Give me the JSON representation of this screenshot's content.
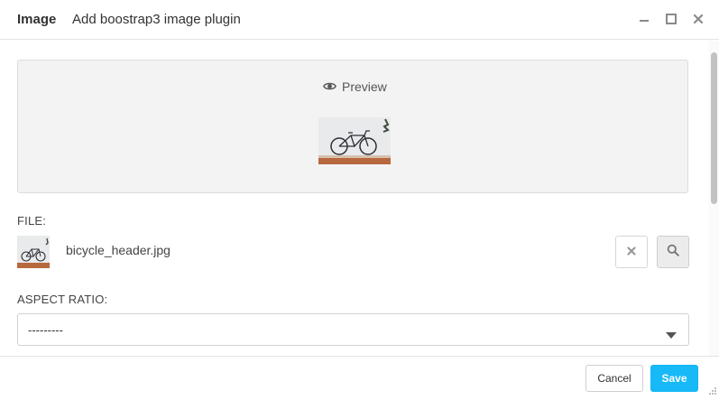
{
  "header": {
    "title": "Image",
    "subtitle": "Add boostrap3 image plugin"
  },
  "preview": {
    "label": "Preview",
    "icon": "eye-icon",
    "image_alt": "bicycle"
  },
  "file": {
    "label": "FILE:",
    "name": "bicycle_header.jpg"
  },
  "aspect_ratio": {
    "label": "ASPECT RATIO:",
    "selected": "---------"
  },
  "footer": {
    "cancel_label": "Cancel",
    "save_label": "Save"
  },
  "colors": {
    "accent": "#18b9f7"
  }
}
